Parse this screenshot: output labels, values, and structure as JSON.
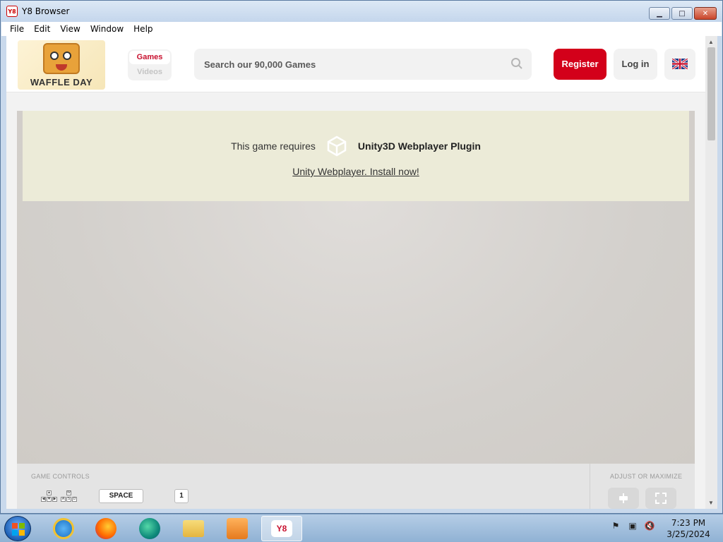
{
  "window": {
    "title": "Y8 Browser",
    "icon_text": "Y8",
    "minimize": "▁",
    "maximize": "□",
    "close": "✕"
  },
  "menu": [
    "File",
    "Edit",
    "View",
    "Window",
    "Help"
  ],
  "header": {
    "logo_text": "WAFFLE DAY",
    "nav_games": "Games",
    "nav_videos": "Videos",
    "search_placeholder": "Search our 90,000 Games",
    "register": "Register",
    "login": "Log in"
  },
  "game": {
    "requires_text": "This game requires",
    "plugin_name": "Unity3D Webplayer Plugin",
    "install_link": "Unity Webplayer. Install now!"
  },
  "controls": {
    "label": "GAME CONTROLS",
    "space_key": "SPACE",
    "one_key": "1",
    "arrows": [
      "▲",
      "◀",
      "▼",
      "▶"
    ],
    "wasd": [
      "W",
      "A",
      "S",
      "D"
    ],
    "adjust_label": "ADJUST OR MAXIMIZE"
  },
  "taskbar": {
    "active_app_label": "Y8",
    "time": "7:23 PM",
    "date": "3/25/2024"
  },
  "colors": {
    "brand_red": "#d3001a",
    "games_red": "#c8102e",
    "plugin_banner": "#ecebd8"
  }
}
